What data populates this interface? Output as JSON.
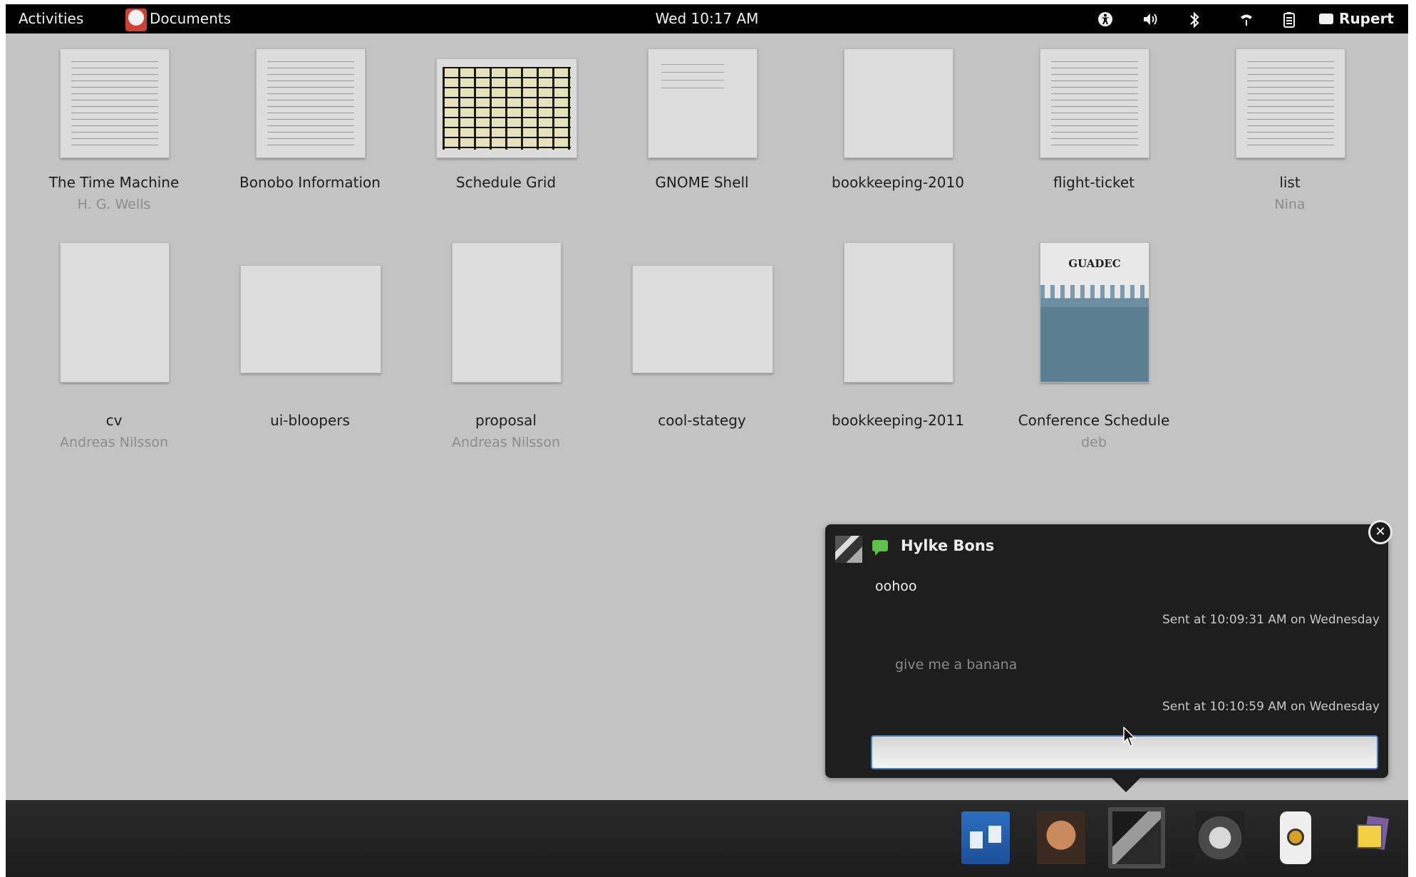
{
  "topbar": {
    "activities": "Activities",
    "app_name": "Documents",
    "clock": "Wed 10:17 AM",
    "user": "Rupert",
    "icons": [
      "accessibility-icon",
      "volume-icon",
      "bluetooth-icon",
      "network-wifi-icon",
      "battery-icon"
    ]
  },
  "documents": [
    {
      "title": "The Time Machine",
      "author": "H. G. Wells",
      "thumb": "text"
    },
    {
      "title": "Bonobo Information",
      "author": "",
      "thumb": "text"
    },
    {
      "title": "Schedule Grid",
      "author": "",
      "thumb": "grid"
    },
    {
      "title": "GNOME Shell",
      "author": "",
      "thumb": "sparse"
    },
    {
      "title": "bookkeeping-2010",
      "author": "",
      "thumb": "blank"
    },
    {
      "title": "flight-ticket",
      "author": "",
      "thumb": "text"
    },
    {
      "title": "list",
      "author": "Nina",
      "thumb": "text"
    },
    {
      "title": "cv",
      "author": "Andreas Nilsson",
      "thumb": "blank"
    },
    {
      "title": "ui-bloopers",
      "author": "",
      "thumb": "blank"
    },
    {
      "title": "proposal",
      "author": "Andreas Nilsson",
      "thumb": "blank"
    },
    {
      "title": "cool-stategy",
      "author": "",
      "thumb": "blank"
    },
    {
      "title": "bookkeeping-2011",
      "author": "",
      "thumb": "blank"
    },
    {
      "title": "Conference Schedule",
      "author": "deb",
      "thumb": "poster",
      "poster_title": "GUADEC"
    }
  ],
  "notification": {
    "sender": "Hylke Bons",
    "messages": [
      {
        "text": "oohoo",
        "time": "Sent at 10:09:31 AM on Wednesday"
      },
      {
        "text": "give me a banana",
        "time": "Sent at 10:10:59 AM on Wednesday"
      }
    ],
    "reply_value": ""
  },
  "tray": {
    "sources": [
      "documents-app",
      "contact-avatar-1",
      "contact-avatar-hylke",
      "contact-avatar-2",
      "sound-app",
      "notes-app"
    ],
    "active_index": 2
  },
  "colors": {
    "desktop_bg": "#c3c3c3",
    "topbar_bg": "#000000",
    "notification_bg": "#1e1e1e",
    "input_focus": "#4a7fd0"
  }
}
